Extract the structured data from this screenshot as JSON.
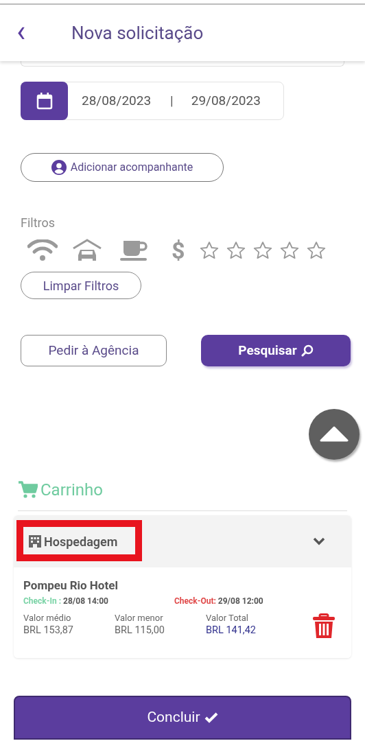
{
  "header": {
    "back_icon": "‹",
    "title": "Nova solicitação"
  },
  "dates": {
    "check_in": "28/08/2023",
    "separator": "|",
    "check_out": "29/08/2023"
  },
  "companion_button": "Adicionar acompanhante",
  "filters": {
    "label": "Filtros",
    "currency_symbol": "$",
    "stars": 0,
    "clear_button": "Limpar Filtros"
  },
  "actions": {
    "agency_button": "Pedir à Agência",
    "search_button": "Pesquisar"
  },
  "cart": {
    "title": "Carrinho",
    "section": {
      "title": "Hospedagem",
      "highlighted": true,
      "expanded": true,
      "item": {
        "name": "Pompeu Rio Hotel",
        "check_in_label": "Check-In :",
        "check_in": "28/08 14:00",
        "check_out_label": "Check-Out:",
        "check_out": "29/08 12:00",
        "values": [
          {
            "label": "Valor médio",
            "amount": "BRL 153,87",
            "kind": "plain"
          },
          {
            "label": "Valor menor",
            "amount": "BRL 115,00",
            "kind": "plain"
          },
          {
            "label": "Valor Total",
            "amount": "BRL 141,42",
            "kind": "total"
          }
        ]
      }
    }
  },
  "finish_button": "Concluir"
}
